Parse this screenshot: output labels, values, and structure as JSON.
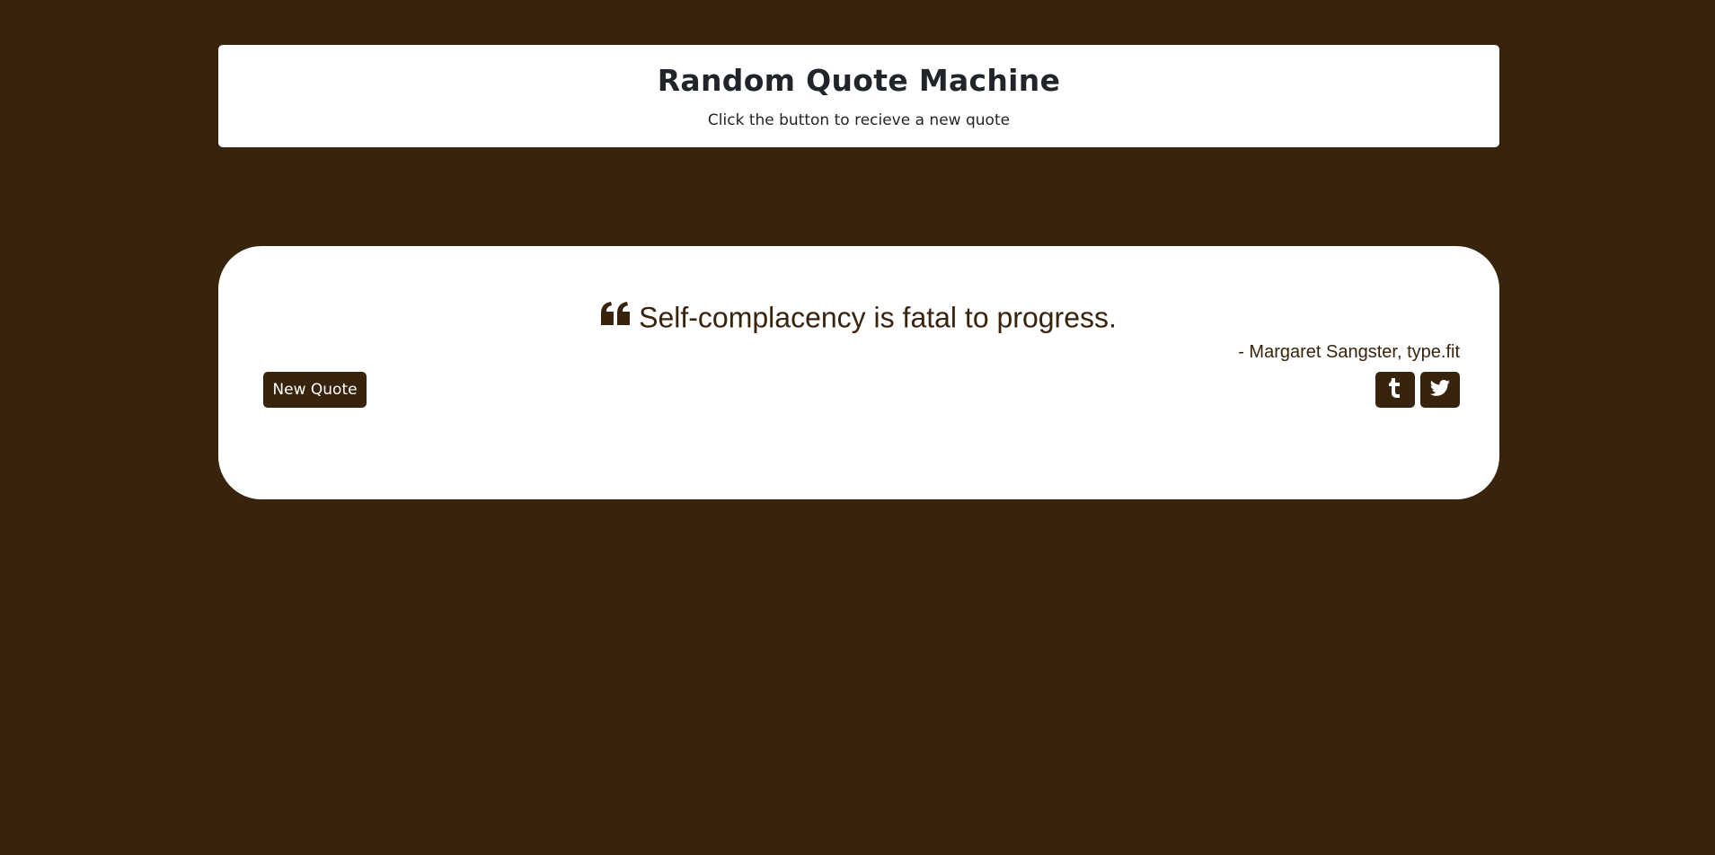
{
  "header": {
    "title": "Random Quote Machine",
    "subtitle": "Click the button to recieve a new quote"
  },
  "quote": {
    "icon": "quote-left-icon",
    "text": "Self-complacency is fatal to progress.",
    "author": "- Margaret Sangster, type.fit"
  },
  "actions": {
    "new_quote_label": "New Quote",
    "share_tumblr_icon": "tumblr-icon",
    "share_twitter_icon": "twitter-icon"
  },
  "colors": {
    "background": "#38230d",
    "card": "#ffffff",
    "accent": "#38230d",
    "heading_text": "#212529"
  }
}
